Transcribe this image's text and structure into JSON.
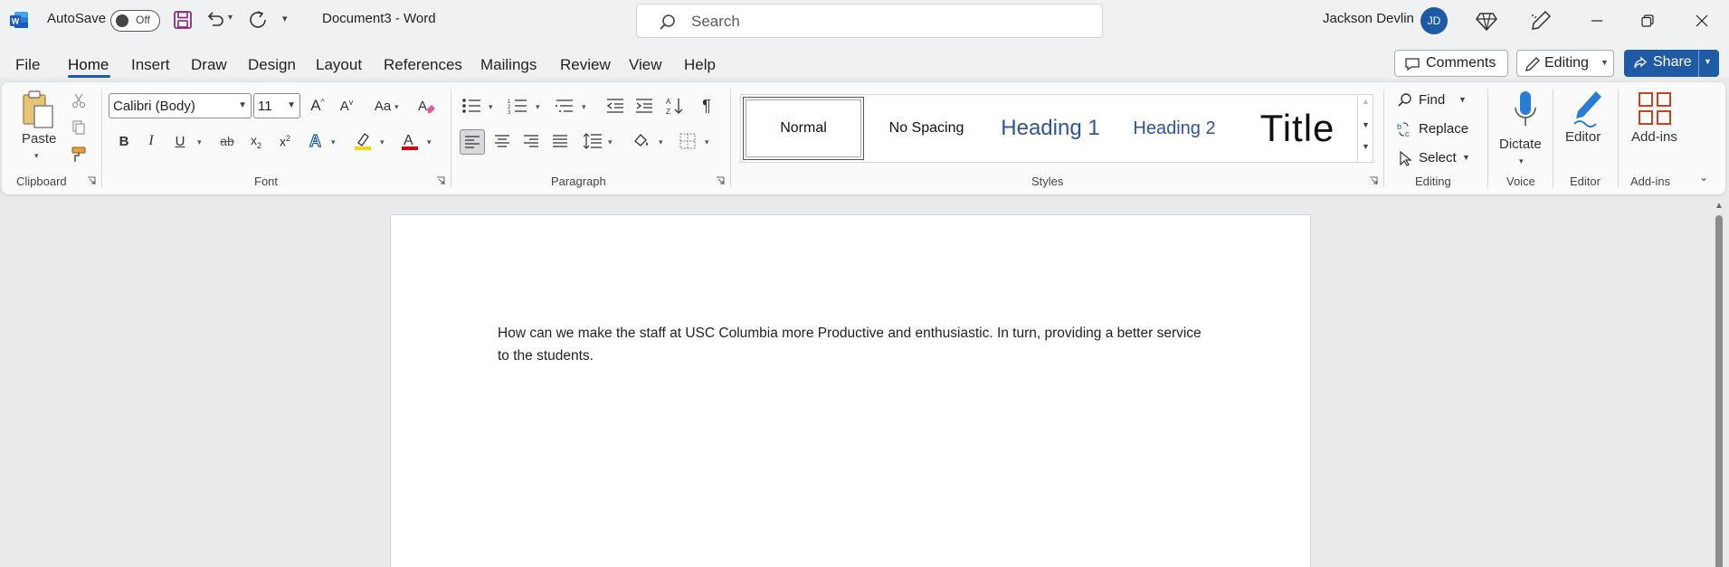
{
  "titlebar": {
    "autosave_label": "AutoSave",
    "autosave_state": "Off",
    "doc_title": "Document3  -  Word",
    "search_placeholder": "Search",
    "user_name": "Jackson Devlin",
    "user_initials": "JD"
  },
  "menu": {
    "tabs": [
      "File",
      "Home",
      "Insert",
      "Draw",
      "Design",
      "Layout",
      "References",
      "Mailings",
      "Review",
      "View",
      "Help"
    ],
    "active_tab": "Home",
    "comments_label": "Comments",
    "editing_label": "Editing",
    "share_label": "Share"
  },
  "ribbon": {
    "clipboard": {
      "paste_label": "Paste",
      "group_label": "Clipboard"
    },
    "font": {
      "font_name": "Calibri (Body)",
      "font_size": "11",
      "group_label": "Font"
    },
    "paragraph": {
      "group_label": "Paragraph"
    },
    "styles": {
      "items": [
        "Normal",
        "No Spacing",
        "Heading 1",
        "Heading 2",
        "Title"
      ],
      "selected": "Normal",
      "group_label": "Styles"
    },
    "editing": {
      "find_label": "Find",
      "replace_label": "Replace",
      "select_label": "Select",
      "group_label": "Editing"
    },
    "voice": {
      "dictate_label": "Dictate",
      "group_label": "Voice"
    },
    "editor": {
      "editor_label": "Editor",
      "group_label": "Editor"
    },
    "addins": {
      "addins_label": "Add-ins",
      "group_label": "Add-ins"
    }
  },
  "document": {
    "body_text": "How can we make the staff at USC Columbia more Productive and enthusiastic. In turn, providing a better service to the students."
  },
  "colors": {
    "accent": "#1e5aa6",
    "titlebar_bg": "#f0f1f3",
    "ribbon_bg": "#fafafa",
    "canvas_bg": "#e9eaec",
    "highlight_yellow": "#ffd400",
    "font_red": "#e00000"
  }
}
